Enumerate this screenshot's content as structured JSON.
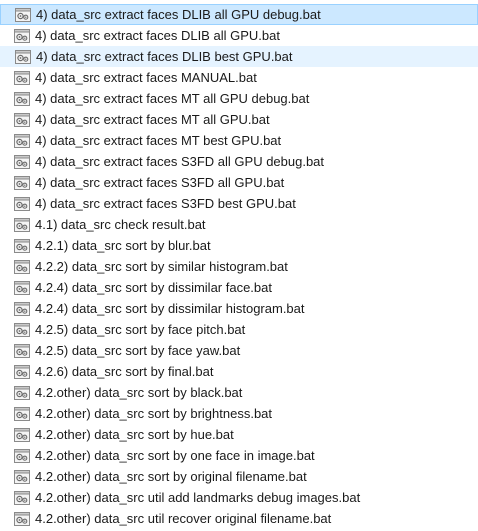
{
  "files": [
    {
      "name": "4) data_src extract faces DLIB all GPU debug.bat",
      "state": "selected"
    },
    {
      "name": "4) data_src extract faces DLIB all GPU.bat",
      "state": "normal"
    },
    {
      "name": "4) data_src extract faces DLIB best GPU.bat",
      "state": "hovered"
    },
    {
      "name": "4) data_src extract faces MANUAL.bat",
      "state": "normal"
    },
    {
      "name": "4) data_src extract faces MT all GPU debug.bat",
      "state": "normal"
    },
    {
      "name": "4) data_src extract faces MT all GPU.bat",
      "state": "normal"
    },
    {
      "name": "4) data_src extract faces MT best GPU.bat",
      "state": "normal"
    },
    {
      "name": "4) data_src extract faces S3FD all GPU debug.bat",
      "state": "normal"
    },
    {
      "name": "4) data_src extract faces S3FD all GPU.bat",
      "state": "normal"
    },
    {
      "name": "4) data_src extract faces S3FD best GPU.bat",
      "state": "normal"
    },
    {
      "name": "4.1) data_src check result.bat",
      "state": "normal"
    },
    {
      "name": "4.2.1) data_src sort by blur.bat",
      "state": "normal"
    },
    {
      "name": "4.2.2) data_src sort by similar histogram.bat",
      "state": "normal"
    },
    {
      "name": "4.2.4) data_src sort by dissimilar face.bat",
      "state": "normal"
    },
    {
      "name": "4.2.4) data_src sort by dissimilar histogram.bat",
      "state": "normal"
    },
    {
      "name": "4.2.5) data_src sort by face pitch.bat",
      "state": "normal"
    },
    {
      "name": "4.2.5) data_src sort by face yaw.bat",
      "state": "normal"
    },
    {
      "name": "4.2.6) data_src sort by final.bat",
      "state": "normal"
    },
    {
      "name": "4.2.other) data_src sort by black.bat",
      "state": "normal"
    },
    {
      "name": "4.2.other) data_src sort by brightness.bat",
      "state": "normal"
    },
    {
      "name": "4.2.other) data_src sort by hue.bat",
      "state": "normal"
    },
    {
      "name": "4.2.other) data_src sort by one face in image.bat",
      "state": "normal"
    },
    {
      "name": "4.2.other) data_src sort by original filename.bat",
      "state": "normal"
    },
    {
      "name": "4.2.other) data_src util add landmarks debug images.bat",
      "state": "normal"
    },
    {
      "name": "4.2.other) data_src util recover original filename.bat",
      "state": "normal"
    }
  ],
  "icon": "batch-file-icon",
  "colors": {
    "selected_bg": "#cce8ff",
    "selected_border": "#99d1ff",
    "hover_bg": "#e5f3ff",
    "text": "#1a1a1a"
  }
}
